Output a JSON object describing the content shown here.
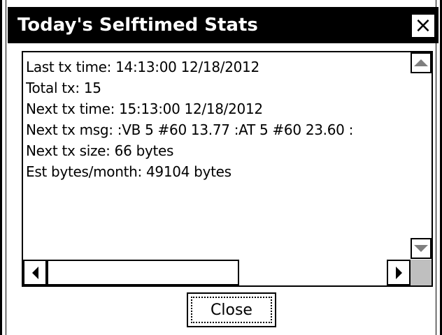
{
  "window": {
    "title": "Today's Selftimed Stats",
    "close_glyph": "×"
  },
  "stats": {
    "lines": [
      "Last tx time: 14:13:00 12/18/2012",
      "Total tx: 15",
      "Next tx time: 15:13:00 12/18/2012",
      "Next tx msg: :VB 5 #60 13.77 :AT 5 #60 23.60 :",
      "Next tx size: 66 bytes",
      "Est bytes/month: 49104 bytes"
    ]
  },
  "buttons": {
    "close_label": "Close"
  },
  "icons": {
    "scroll_up": "scroll-up-arrow-icon",
    "scroll_down": "scroll-down-arrow-icon",
    "scroll_left": "scroll-left-arrow-icon",
    "scroll_right": "scroll-right-arrow-icon"
  },
  "colors": {
    "titlebar_bg": "#000000",
    "title_text": "#ffffff",
    "disabled_arrow": "#7f7f7f",
    "scroll_corner": "#bfbfbf"
  }
}
